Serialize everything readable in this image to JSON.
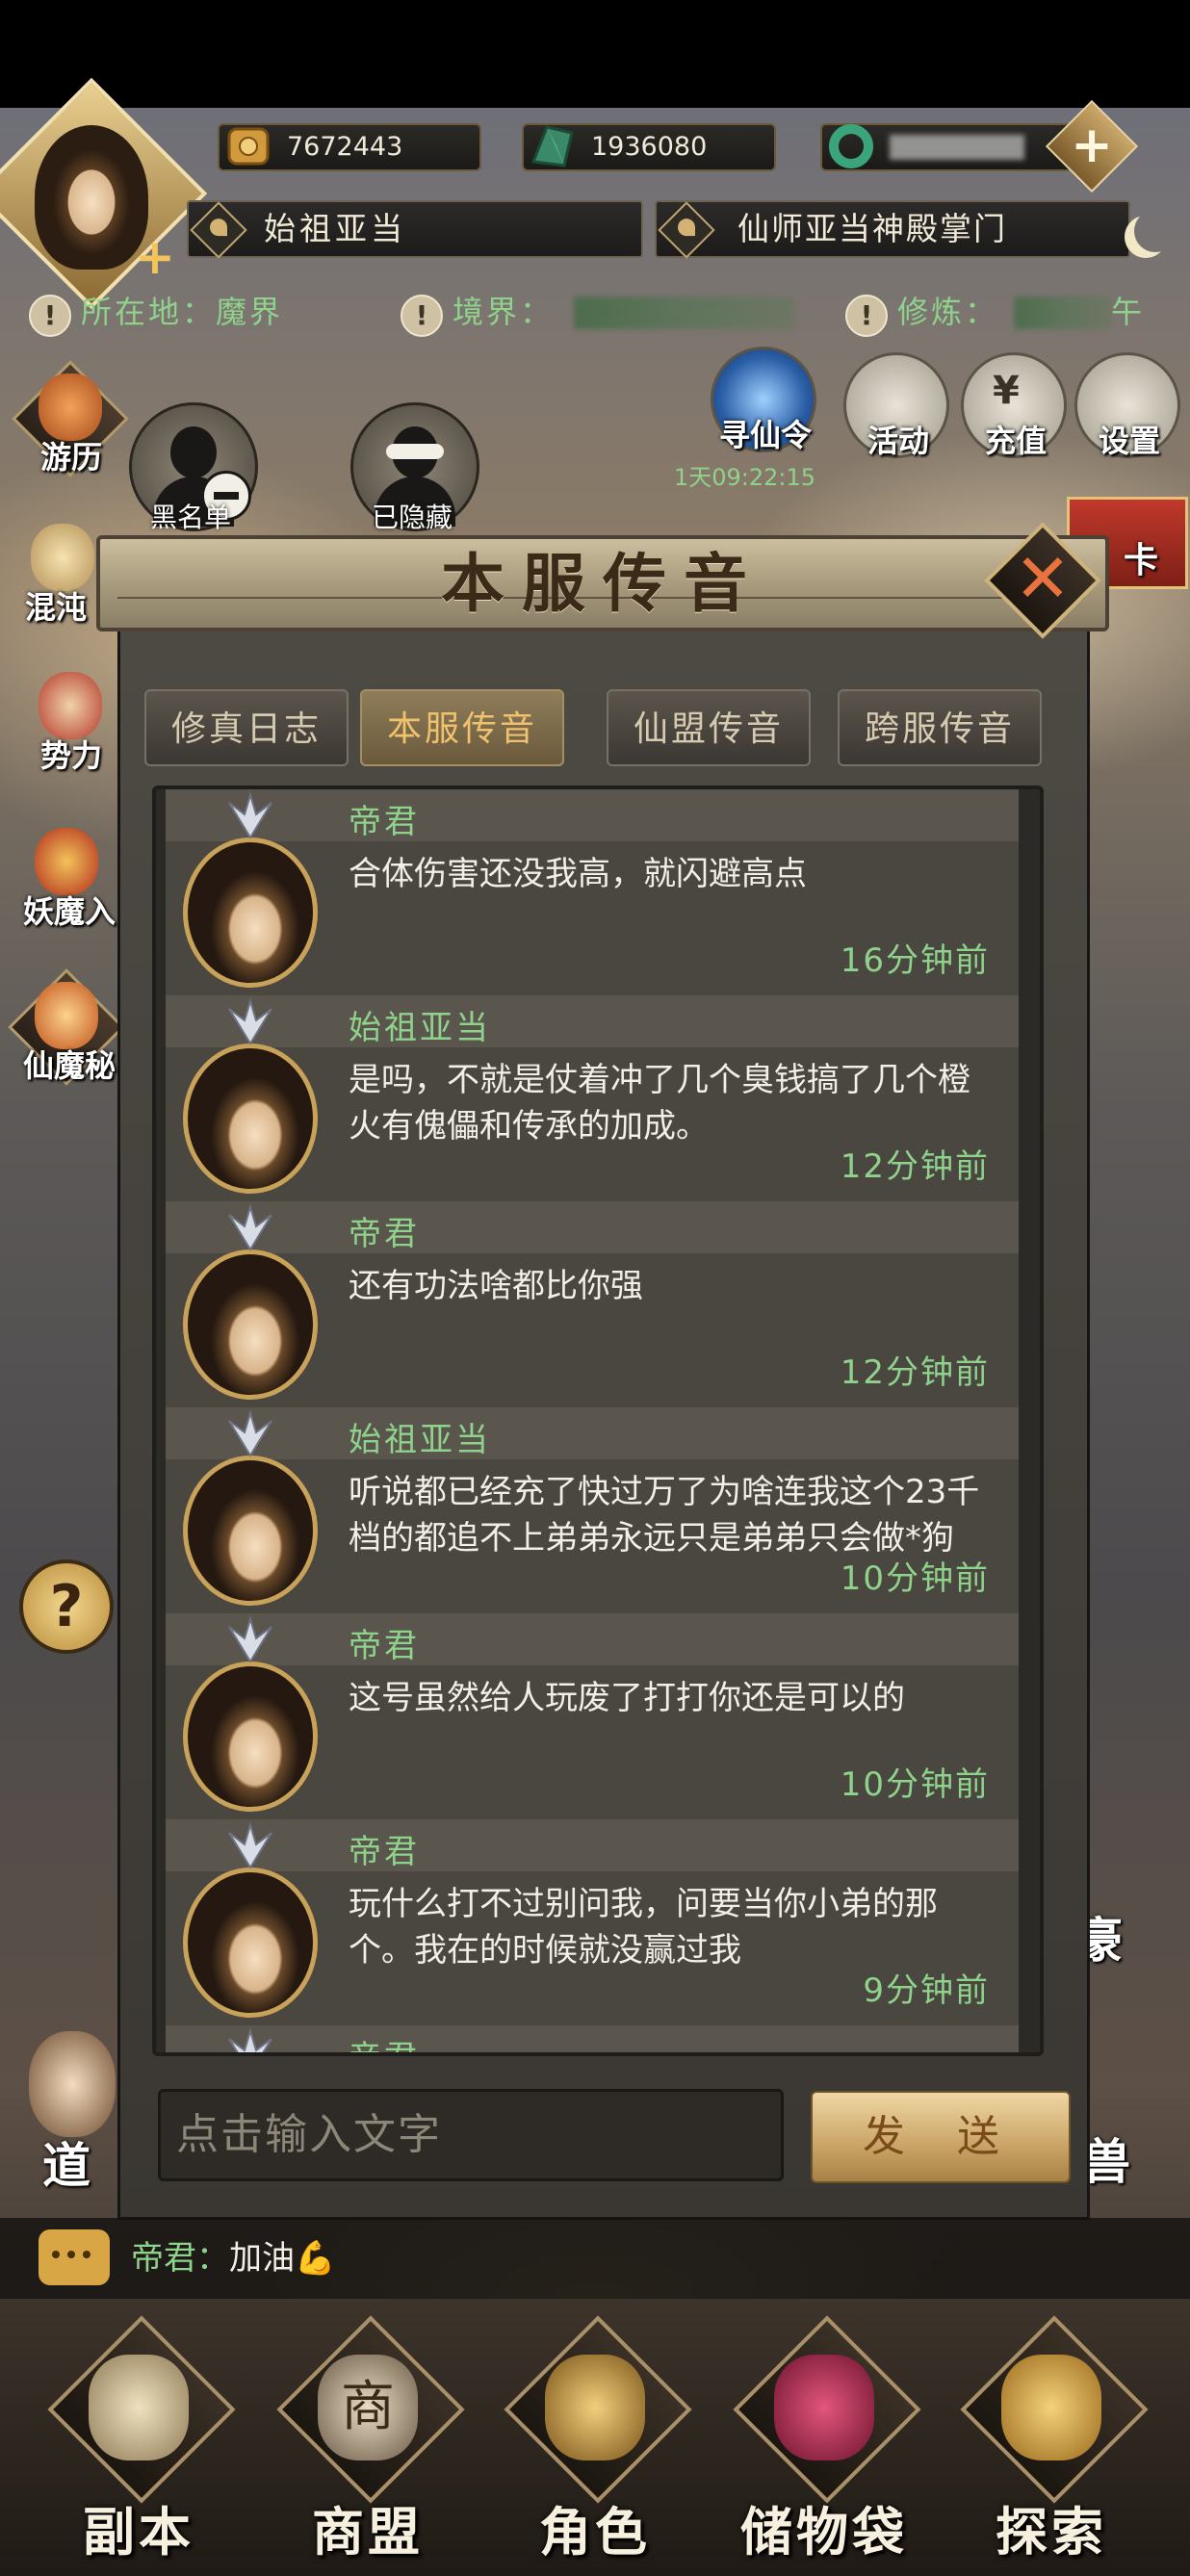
{
  "header": {
    "gold_value": "7672443",
    "jade_value": "1936080",
    "player_name": "始祖亚当",
    "player_title": "仙师亚当神殿掌门"
  },
  "status_row": {
    "location": "所在地：魔界",
    "realm": "境界：",
    "cultivation": "修炼：",
    "cultivation_tail": "午"
  },
  "top_right_icons": [
    {
      "label": "寻仙令"
    },
    {
      "label": "活动"
    },
    {
      "label": "充值",
      "coin": "¥"
    },
    {
      "label": "设置"
    }
  ],
  "timer": "1天09:22:15",
  "left_icons": [
    {
      "label": "游历"
    },
    {
      "label": "混沌"
    },
    {
      "label": "势力"
    },
    {
      "label": "妖魔入"
    },
    {
      "label": "仙魔秘"
    }
  ],
  "right_edge": {
    "card_label": "卡",
    "side_a": "豪",
    "side_b": "兽"
  },
  "left_edge": {
    "label": "道"
  },
  "blacklist": {
    "label": "黑名单"
  },
  "hidden": {
    "label": "已隐藏"
  },
  "dialog": {
    "title": "本服传音",
    "tabs": [
      {
        "label": "修真日志",
        "active": false
      },
      {
        "label": "本服传音",
        "active": true
      },
      {
        "label": "仙盟传音",
        "active": false
      },
      {
        "label": "跨服传音",
        "active": false
      }
    ],
    "messages": [
      {
        "name": "帝君",
        "text": "合体伤害还没我高，就闪避高点",
        "time": "16分钟前"
      },
      {
        "name": "始祖亚当",
        "text": "是吗，不就是仗着冲了几个臭钱搞了几个橙火有傀儡和传承的加成。",
        "time": "12分钟前"
      },
      {
        "name": "帝君",
        "text": "还有功法啥都比你强",
        "time": "12分钟前"
      },
      {
        "name": "始祖亚当",
        "text": "听说都已经充了快过万了为啥连我这个23千档的都追不上弟弟永远只是弟弟只会做*狗",
        "time": "10分钟前"
      },
      {
        "name": "帝君",
        "text": "这号虽然给人玩废了打打你还是可以的",
        "time": "10分钟前"
      },
      {
        "name": "帝君",
        "text": "玩什么打不过别问我，问要当你小弟的那个。我在的时候就没赢过我",
        "time": "9分钟前"
      },
      {
        "name": "帝君",
        "text": "",
        "time": ""
      }
    ],
    "input_placeholder": "点击输入文字",
    "send_label": "发 送"
  },
  "chat_preview": {
    "speaker": "帝君：",
    "message": "加油💪"
  },
  "bottom_nav": [
    {
      "label": "副本"
    },
    {
      "label": "商盟",
      "sign": "商"
    },
    {
      "label": "角色"
    },
    {
      "label": "储物袋"
    },
    {
      "label": "探索"
    }
  ],
  "help": {
    "label": "?"
  },
  "close": {
    "label": "✕"
  }
}
